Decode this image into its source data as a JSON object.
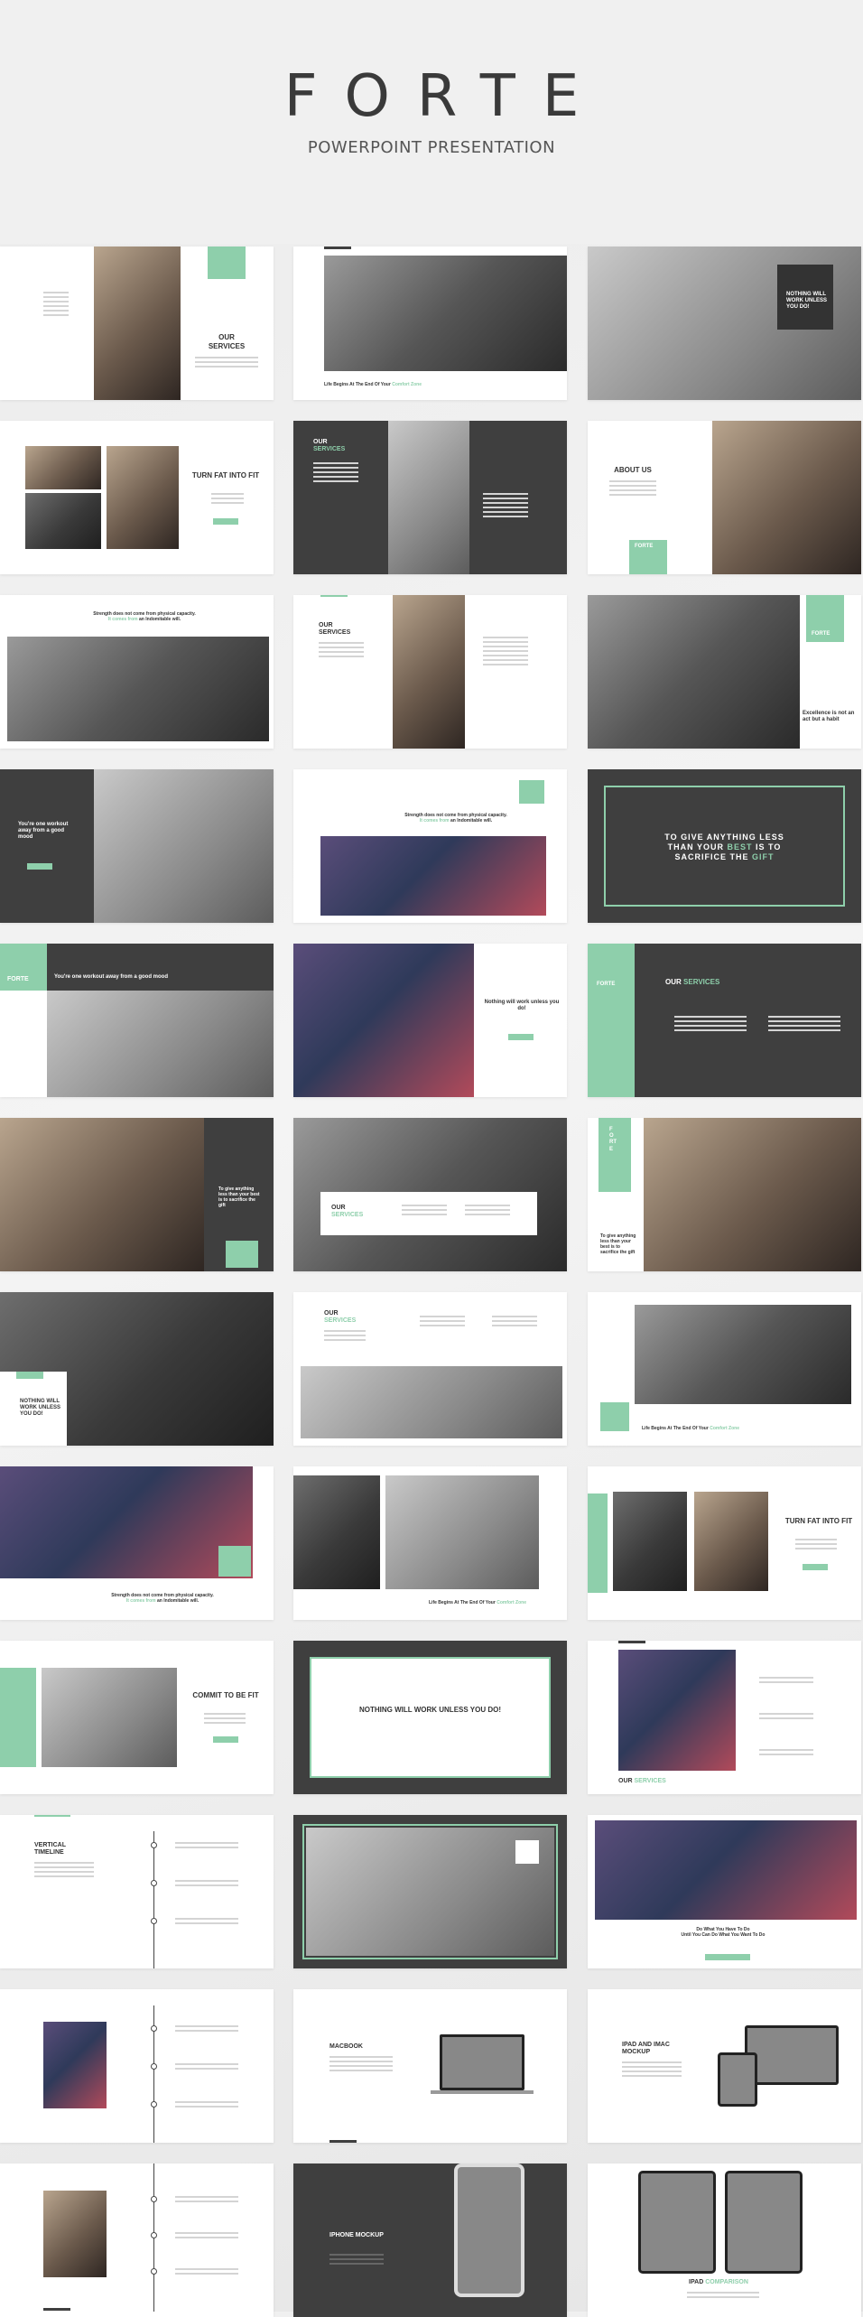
{
  "header": {
    "title": "FORTE",
    "subtitle": "POWERPOINT PRESENTATION"
  },
  "texts": {
    "our_services": "OUR SERVICES",
    "our": "OUR",
    "services": "SERVICES",
    "nothing_will_work": "NOTHING WILL WORK UNLESS YOU DO!",
    "life_begins": "Life Begins At The End Of Your",
    "life_begins_acc": "Comfort Zone",
    "turn_fat": "TURN FAT INTO FIT",
    "about_us": "ABOUT US",
    "forte": "FORTE",
    "strength_1": "Strength does not come from physical capacity.",
    "strength_2a": "It comes from",
    "strength_2b": "an Indomitable will.",
    "excellence": "Excellence is not an act but a habit",
    "youre_one": "You're one workout away from a good mood",
    "quote_1": "TO GIVE ANYTHING LESS",
    "quote_2a": "THAN YOUR",
    "quote_2b": "BEST",
    "quote_2c": "IS TO",
    "quote_3a": "SACRIFICE THE",
    "quote_3b": "GIFT",
    "nothing_will_unless": "Nothing will work unless you do!",
    "to_give_short": "To give anything less than your best is to sacrifice the gift",
    "commit": "COMMIT TO BE FIT",
    "vertical_timeline": "VERTICAL TIMELINE",
    "do_what_1": "Do What You Have To Do",
    "do_what_2": "Until You Can Do What You Want To Do",
    "macbook": "MACBOOK",
    "ipad_imac": "IPAD AND IMAC MOCKUP",
    "iphone": "IPHONE MOCKUP",
    "ipad_comparison": "IPAD",
    "ipad_comparison_acc": "COMPARISON"
  }
}
